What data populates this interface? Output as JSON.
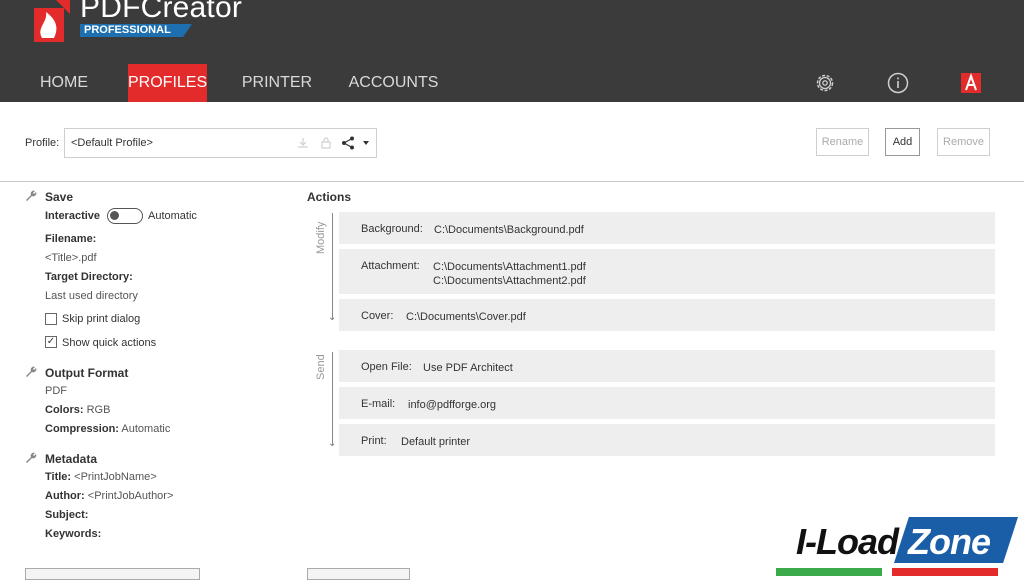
{
  "app": {
    "name": "PDFCreator",
    "edition": "PROFESSIONAL"
  },
  "nav": {
    "items": [
      "HOME",
      "PROFILES",
      "PRINTER",
      "ACCOUNTS"
    ],
    "active": "PROFILES"
  },
  "profile": {
    "label": "Profile:",
    "selected": "<Default Profile>",
    "rename": "Rename",
    "add": "Add",
    "remove": "Remove"
  },
  "save": {
    "title": "Save",
    "interactive": "Interactive",
    "automatic": "Automatic",
    "filename_label": "Filename:",
    "filename": "<Title>.pdf",
    "target_label": "Target Directory:",
    "target": "Last used directory",
    "skip_print": "Skip print dialog",
    "show_quick": "Show quick actions"
  },
  "output": {
    "title": "Output Format",
    "format": "PDF",
    "colors_label": "Colors:",
    "colors": "RGB",
    "compression_label": "Compression:",
    "compression": "Automatic"
  },
  "metadata": {
    "title": "Metadata",
    "title_label": "Title:",
    "title_val": "<PrintJobName>",
    "author_label": "Author:",
    "author_val": "<PrintJobAuthor>",
    "subject_label": "Subject:",
    "keywords_label": "Keywords:"
  },
  "actions": {
    "title": "Actions",
    "modify_label": "Modify",
    "send_label": "Send",
    "modify": [
      {
        "key": "Background:",
        "value": "C:\\Documents\\Background.pdf"
      },
      {
        "key": "Attachment:",
        "value": "C:\\Documents\\Attachment1.pdf\nC:\\Documents\\Attachment2.pdf"
      },
      {
        "key": "Cover:",
        "value": "C:\\Documents\\Cover.pdf"
      }
    ],
    "send": [
      {
        "key": "Open File:",
        "value": "Use PDF Architect"
      },
      {
        "key": "E-mail:",
        "value": "info@pdfforge.org"
      },
      {
        "key": "Print:",
        "value": "Default printer"
      }
    ]
  },
  "watermark": {
    "part1": "I-Load",
    "part2": "Zone"
  },
  "colors": {
    "accent": "#e32b2b",
    "header": "#3b3b3b",
    "card": "#eeeeee"
  }
}
